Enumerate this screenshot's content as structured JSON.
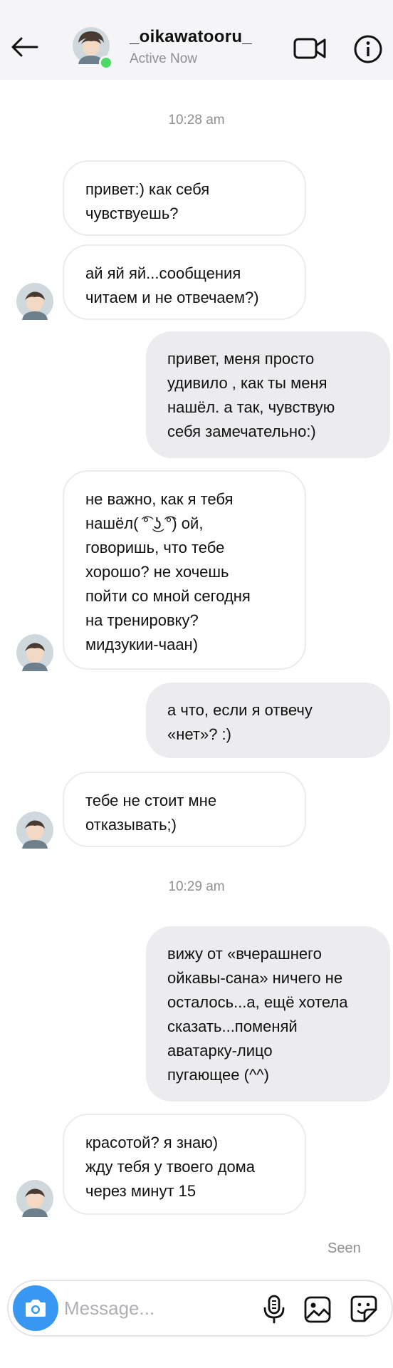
{
  "header": {
    "username": "_oikawatooru_",
    "status": "Active Now",
    "online_color": "#4cd964",
    "icons": [
      "back-arrow-icon",
      "video-camera-icon",
      "info-icon"
    ]
  },
  "conversation": {
    "timestamps": [
      "10:28 am",
      "10:29 am"
    ],
    "messages": [
      {
        "from": "contact",
        "text": "привет:) как себя\nчувствуешь?"
      },
      {
        "from": "contact",
        "text": "ай яй яй...сообщения\nчитаем и не отвечаем?)"
      },
      {
        "from": "me",
        "text": "привет, меня просто\nудивило , как ты меня\nнашёл. а так, чувствую\nсебя замечательно:)"
      },
      {
        "from": "contact",
        "text": "не важно, как я тебя\nнашёл( ͡° ͜ʖ ͡°) ой,\nговоришь, что тебе\nхорошо? не хочешь\nпойти со мной сегодня\nна тренировку?\nмидзукии-чаан)"
      },
      {
        "from": "me",
        "text": "а что, если я отвечу\n«нет»? :)"
      },
      {
        "from": "contact",
        "text": "тебе не стоит мне\nотказывать;)"
      },
      {
        "from": "me",
        "text": "вижу от «вчерашнего\nойкавы-сана» ничего не\nосталось...а, ещё хотела\nсказать...поменяй\nаватарку-лицо\nпугающее (^^)"
      },
      {
        "from": "contact",
        "text": "красотой? я знаю)\nжду тебя у твоего дома\nчерез минут 15"
      }
    ],
    "seen_label": "Seen"
  },
  "composer": {
    "placeholder": "Message...",
    "accent": "#3897f0",
    "icons": [
      "camera-icon",
      "microphone-icon",
      "gallery-icon",
      "sticker-icon"
    ]
  }
}
